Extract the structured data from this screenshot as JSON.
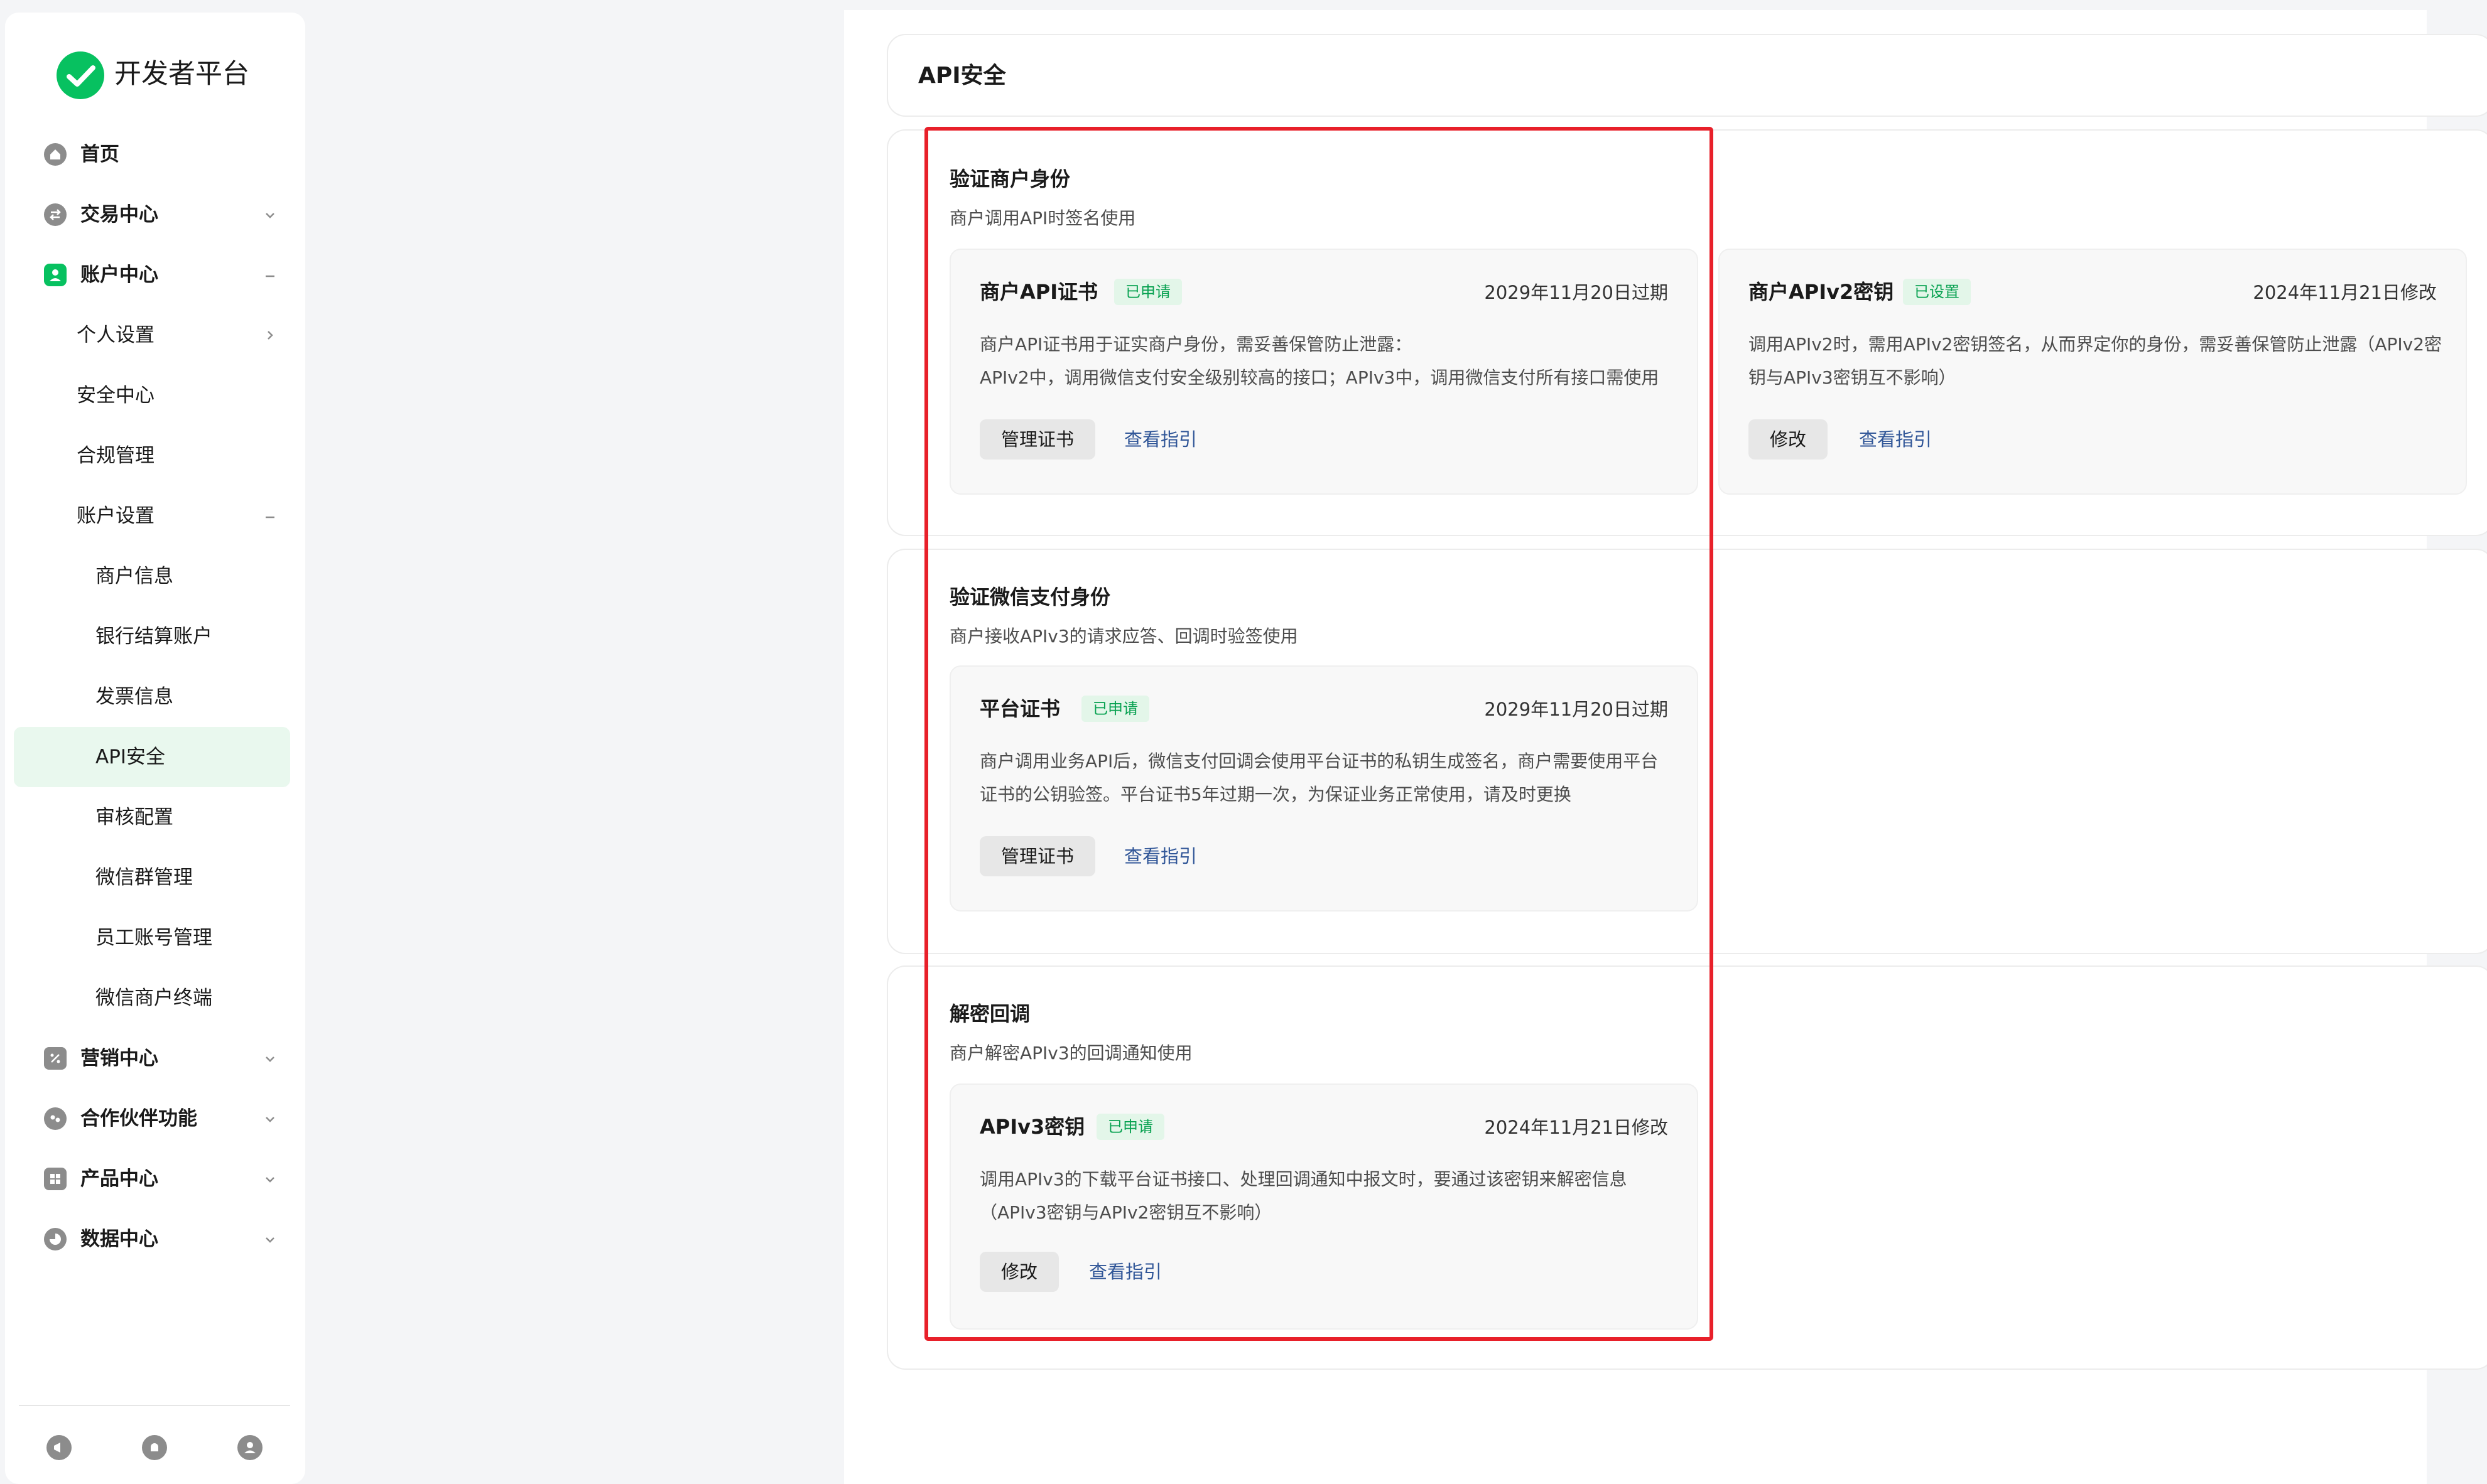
{
  "brand": {
    "name": "开发者平台",
    "logo_icon": "wechat-pay-logo",
    "accent": "#07c160"
  },
  "sidebar": {
    "items": [
      {
        "label": "首页",
        "icon": "home-icon",
        "level": 1
      },
      {
        "label": "交易中心",
        "icon": "exchange-icon",
        "level": 1,
        "chevron": "down"
      },
      {
        "label": "账户中心",
        "icon": "account-icon",
        "level": 1,
        "chevron": "collapse"
      },
      {
        "label": "个人设置",
        "level": 2,
        "chevron": "right"
      },
      {
        "label": "安全中心",
        "level": 2
      },
      {
        "label": "合规管理",
        "level": 2
      },
      {
        "label": "账户设置",
        "level": 2,
        "chevron": "collapse"
      },
      {
        "label": "商户信息",
        "level": 3
      },
      {
        "label": "银行结算账户",
        "level": 3
      },
      {
        "label": "发票信息",
        "level": 3
      },
      {
        "label": "API安全",
        "level": 3,
        "active": true
      },
      {
        "label": "审核配置",
        "level": 3
      },
      {
        "label": "微信群管理",
        "level": 3
      },
      {
        "label": "员工账号管理",
        "level": 3
      },
      {
        "label": "微信商户终端",
        "level": 3
      },
      {
        "label": "营销中心",
        "icon": "marketing-icon",
        "level": 1,
        "chevron": "down"
      },
      {
        "label": "合作伙伴功能",
        "icon": "partner-icon",
        "level": 1,
        "chevron": "down"
      },
      {
        "label": "产品中心",
        "icon": "product-icon",
        "level": 1,
        "chevron": "down"
      },
      {
        "label": "数据中心",
        "icon": "data-icon",
        "level": 1,
        "chevron": "down"
      }
    ],
    "footer_icons": [
      "announcement-icon",
      "notification-bell-icon",
      "user-profile-icon"
    ]
  },
  "page": {
    "title": "API安全"
  },
  "sections": {
    "merchant_identity": {
      "title": "验证商户身份",
      "desc": "商户调用API时签名使用",
      "cards": {
        "api_cert": {
          "name": "商户API证书",
          "badge": "已申请",
          "date": "2029年11月20日过期",
          "desc_line1": "商户API证书用于证实商户身份，需妥善保管防止泄露：",
          "desc_line2": "APIv2中，调用微信支付安全级别较高的接口；APIv3中，调用微信支付所有接口需使用",
          "button": "管理证书",
          "link": "查看指引"
        },
        "apiv2_key": {
          "name": "商户APIv2密钥",
          "badge": "已设置",
          "date": "2024年11月21日修改",
          "desc_line1": "调用APIv2时，需用APIv2密钥签名，从而界定你的身份，需妥善保管防止泄露（APIv2密",
          "desc_line2": "钥与APIv3密钥互不影响）",
          "button": "修改",
          "link": "查看指引"
        }
      }
    },
    "wechatpay_identity": {
      "title": "验证微信支付身份",
      "desc": "商户接收APIv3的请求应答、回调时验签使用",
      "cards": {
        "platform_cert": {
          "name": "平台证书",
          "badge": "已申请",
          "date": "2029年11月20日过期",
          "desc_line1": "商户调用业务API后，微信支付回调会使用平台证书的私钥生成签名，商户需要使用平台",
          "desc_line2": "证书的公钥验签。平台证书5年过期一次，为保证业务正常使用，请及时更换",
          "button": "管理证书",
          "link": "查看指引"
        }
      }
    },
    "decrypt_callback": {
      "title": "解密回调",
      "desc": "商户解密APIv3的回调通知使用",
      "cards": {
        "apiv3_key": {
          "name": "APIv3密钥",
          "badge": "已申请",
          "date": "2024年11月21日修改",
          "desc_line1": "调用APIv3的下载平台证书接口、处理回调通知中报文时，要通过该密钥来解密信息",
          "desc_line2": "（APIv3密钥与APIv2密钥互不影响）",
          "button": "修改",
          "link": "查看指引"
        }
      }
    }
  },
  "colors": {
    "badge_text": "#07a150",
    "badge_bg": "#e3f6e9",
    "link": "#2f5597",
    "highlight": "#e8202a"
  }
}
